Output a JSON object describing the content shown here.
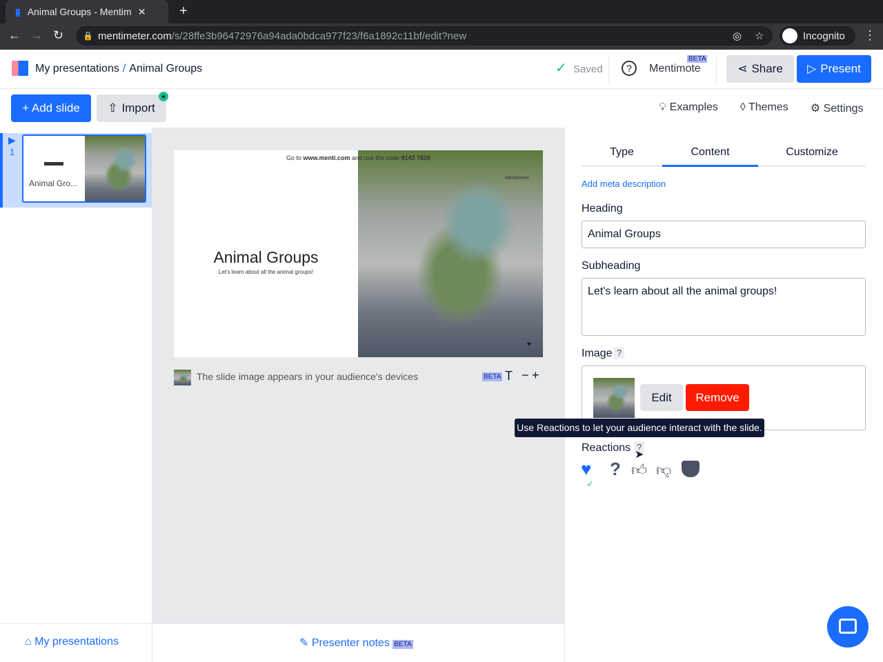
{
  "browser": {
    "tab_title": "Animal Groups - Mentimeter",
    "url_domain": "mentimeter.com",
    "url_path": "/s/28ffe3b96472976a94ada0bdca977f23/f6a1892c11bf/edit?new",
    "profile": "Incognito"
  },
  "header": {
    "breadcrumb_root": "My presentations",
    "breadcrumb_sep": "/",
    "breadcrumb_current": "Animal Groups",
    "saved": "Saved",
    "mentimote": "Mentimote",
    "beta": "BETA",
    "share": "Share",
    "present": "Present"
  },
  "toolbar": {
    "add_slide": "+ Add slide",
    "import": "Import",
    "examples": "Examples",
    "themes": "Themes",
    "settings": "Settings"
  },
  "slides": [
    {
      "number": "1",
      "title": "Animal Gro..."
    }
  ],
  "slide": {
    "join_prefix": "Go to",
    "join_site": "www.menti.com",
    "join_mid": "and use the code",
    "join_code": "8143 7626",
    "heading": "Animal Groups",
    "subheading": "Let's learn about all the animal groups!",
    "brand": "Mentimeter"
  },
  "preview_footer": {
    "text": "The slide image appears in your audience's devices",
    "beta": "BETA"
  },
  "panel": {
    "tabs": [
      "Type",
      "Content",
      "Customize"
    ],
    "active_tab": "Content",
    "meta_link": "Add meta description",
    "heading_label": "Heading",
    "heading_value": "Animal Groups",
    "subheading_label": "Subheading",
    "subheading_value": "Let's learn about all the animal groups!",
    "image_label": "Image",
    "help": "?",
    "edit": "Edit",
    "remove": "Remove",
    "tooltip": "Use Reactions to let your audience interact with the slide.",
    "reactions_label": "Reactions"
  },
  "footer": {
    "my_presentations": "My presentations",
    "presenter_notes": "Presenter notes",
    "beta": "BETA"
  },
  "colors": {
    "accent": "#196cff",
    "remove": "#ff1a00",
    "saved_check": "#1fbf8f"
  }
}
